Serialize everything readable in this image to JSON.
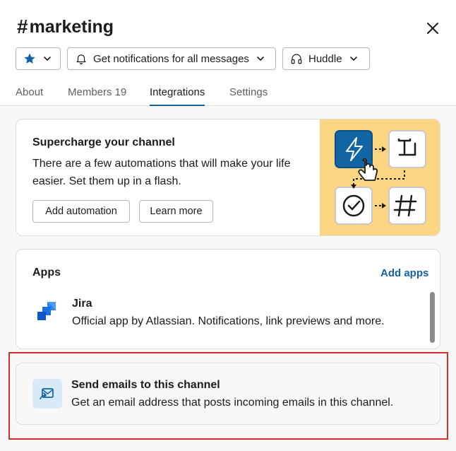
{
  "header": {
    "hash": "#",
    "title": "marketing",
    "star_menu_icon": "star-icon",
    "notifications_label": "Get notifications for all messages",
    "huddle_label": "Huddle"
  },
  "tabs": [
    {
      "label": "About"
    },
    {
      "label": "Members",
      "count": "19"
    },
    {
      "label": "Integrations",
      "active": true
    },
    {
      "label": "Settings"
    }
  ],
  "supercharge": {
    "title": "Supercharge your channel",
    "description": "There are a few automations that will make your life easier. Set them up in a flash.",
    "add_automation_label": "Add automation",
    "learn_more_label": "Learn more"
  },
  "apps": {
    "title": "Apps",
    "add_apps_label": "Add apps",
    "items": [
      {
        "name": "Jira",
        "description": "Official app by Atlassian. Notifications, link previews and more."
      }
    ]
  },
  "email": {
    "title": "Send emails to this channel",
    "description": "Get an email address that posts incoming emails in this channel."
  },
  "colors": {
    "accent": "#1264a3",
    "highlight": "#d32f2f",
    "illustration_bg": "#fbd581"
  }
}
